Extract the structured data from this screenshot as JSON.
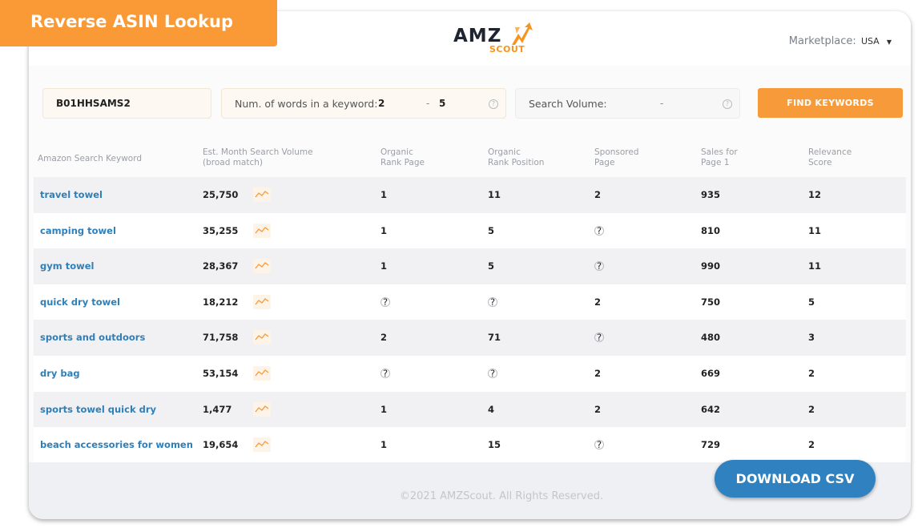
{
  "badge": {
    "title": "Reverse ASIN Lookup"
  },
  "logo": {
    "word": "AMZ",
    "sub": "SCOUT",
    "icon": "amzscout-arrow-icon"
  },
  "marketplace": {
    "label": "Marketplace:",
    "value": "USA"
  },
  "filters": {
    "asin_value": "B01HHSAMS2",
    "words_label": "Num. of words in a keyword:",
    "words_min": "2",
    "words_sep": "-",
    "words_max": "5",
    "volume_label": "Search Volume:",
    "volume_sep": "-",
    "find_button": "FIND KEYWORDS"
  },
  "table": {
    "headers": [
      {
        "line1": "Amazon Search Keyword",
        "line2": ""
      },
      {
        "line1": "Est. Month Search Volume",
        "line2": "(broad match)"
      },
      {
        "line1": "Organic",
        "line2": "Rank Page"
      },
      {
        "line1": "Organic",
        "line2": "Rank Position"
      },
      {
        "line1": "Sponsored",
        "line2": "Page"
      },
      {
        "line1": "Sales for",
        "line2": "Page 1"
      },
      {
        "line1": "Relevance",
        "line2": "Score"
      }
    ],
    "rows": [
      {
        "keyword": "travel towel",
        "volume": "25,750",
        "rank_page": "1",
        "rank_pos": "11",
        "sponsored": "2",
        "sales": "935",
        "relevance": "12"
      },
      {
        "keyword": "camping towel",
        "volume": "35,255",
        "rank_page": "1",
        "rank_pos": "5",
        "sponsored": "?",
        "sales": "810",
        "relevance": "11"
      },
      {
        "keyword": "gym towel",
        "volume": "28,367",
        "rank_page": "1",
        "rank_pos": "5",
        "sponsored": "?",
        "sales": "990",
        "relevance": "11"
      },
      {
        "keyword": "quick dry towel",
        "volume": "18,212",
        "rank_page": "?",
        "rank_pos": "?",
        "sponsored": "2",
        "sales": "750",
        "relevance": "5"
      },
      {
        "keyword": "sports and outdoors",
        "volume": "71,758",
        "rank_page": "2",
        "rank_pos": "71",
        "sponsored": "?",
        "sales": "480",
        "relevance": "3"
      },
      {
        "keyword": "dry bag",
        "volume": "53,154",
        "rank_page": "?",
        "rank_pos": "?",
        "sponsored": "2",
        "sales": "669",
        "relevance": "2"
      },
      {
        "keyword": "sports towel quick dry",
        "volume": "1,477",
        "rank_page": "1",
        "rank_pos": "4",
        "sponsored": "2",
        "sales": "642",
        "relevance": "2"
      },
      {
        "keyword": "beach accessories for women",
        "volume": "19,654",
        "rank_page": "1",
        "rank_pos": "15",
        "sponsored": "?",
        "sales": "729",
        "relevance": "2"
      }
    ]
  },
  "footer": {
    "copyright": "©2021 AMZScout. All Rights Reserved.",
    "download_button": "DOWNLOAD CSV"
  },
  "colors": {
    "accent": "#f99a36",
    "link": "#2f7fb8",
    "download": "#2f82bf"
  }
}
